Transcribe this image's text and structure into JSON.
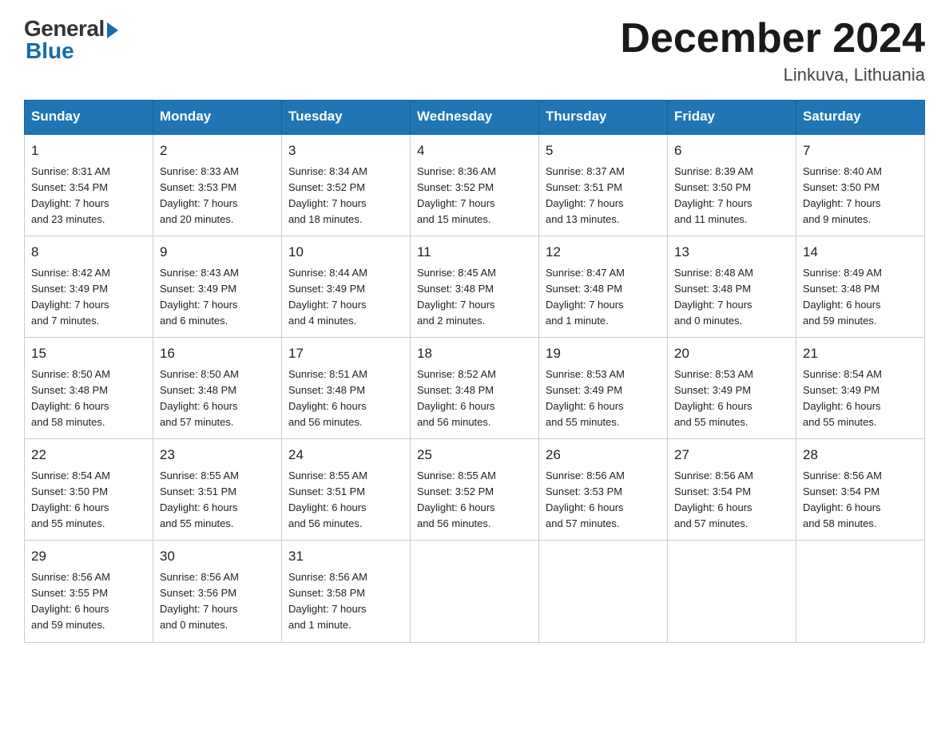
{
  "logo": {
    "general": "General",
    "blue": "Blue"
  },
  "title": "December 2024",
  "location": "Linkuva, Lithuania",
  "days_of_week": [
    "Sunday",
    "Monday",
    "Tuesday",
    "Wednesday",
    "Thursday",
    "Friday",
    "Saturday"
  ],
  "weeks": [
    [
      {
        "day": "1",
        "info": "Sunrise: 8:31 AM\nSunset: 3:54 PM\nDaylight: 7 hours\nand 23 minutes."
      },
      {
        "day": "2",
        "info": "Sunrise: 8:33 AM\nSunset: 3:53 PM\nDaylight: 7 hours\nand 20 minutes."
      },
      {
        "day": "3",
        "info": "Sunrise: 8:34 AM\nSunset: 3:52 PM\nDaylight: 7 hours\nand 18 minutes."
      },
      {
        "day": "4",
        "info": "Sunrise: 8:36 AM\nSunset: 3:52 PM\nDaylight: 7 hours\nand 15 minutes."
      },
      {
        "day": "5",
        "info": "Sunrise: 8:37 AM\nSunset: 3:51 PM\nDaylight: 7 hours\nand 13 minutes."
      },
      {
        "day": "6",
        "info": "Sunrise: 8:39 AM\nSunset: 3:50 PM\nDaylight: 7 hours\nand 11 minutes."
      },
      {
        "day": "7",
        "info": "Sunrise: 8:40 AM\nSunset: 3:50 PM\nDaylight: 7 hours\nand 9 minutes."
      }
    ],
    [
      {
        "day": "8",
        "info": "Sunrise: 8:42 AM\nSunset: 3:49 PM\nDaylight: 7 hours\nand 7 minutes."
      },
      {
        "day": "9",
        "info": "Sunrise: 8:43 AM\nSunset: 3:49 PM\nDaylight: 7 hours\nand 6 minutes."
      },
      {
        "day": "10",
        "info": "Sunrise: 8:44 AM\nSunset: 3:49 PM\nDaylight: 7 hours\nand 4 minutes."
      },
      {
        "day": "11",
        "info": "Sunrise: 8:45 AM\nSunset: 3:48 PM\nDaylight: 7 hours\nand 2 minutes."
      },
      {
        "day": "12",
        "info": "Sunrise: 8:47 AM\nSunset: 3:48 PM\nDaylight: 7 hours\nand 1 minute."
      },
      {
        "day": "13",
        "info": "Sunrise: 8:48 AM\nSunset: 3:48 PM\nDaylight: 7 hours\nand 0 minutes."
      },
      {
        "day": "14",
        "info": "Sunrise: 8:49 AM\nSunset: 3:48 PM\nDaylight: 6 hours\nand 59 minutes."
      }
    ],
    [
      {
        "day": "15",
        "info": "Sunrise: 8:50 AM\nSunset: 3:48 PM\nDaylight: 6 hours\nand 58 minutes."
      },
      {
        "day": "16",
        "info": "Sunrise: 8:50 AM\nSunset: 3:48 PM\nDaylight: 6 hours\nand 57 minutes."
      },
      {
        "day": "17",
        "info": "Sunrise: 8:51 AM\nSunset: 3:48 PM\nDaylight: 6 hours\nand 56 minutes."
      },
      {
        "day": "18",
        "info": "Sunrise: 8:52 AM\nSunset: 3:48 PM\nDaylight: 6 hours\nand 56 minutes."
      },
      {
        "day": "19",
        "info": "Sunrise: 8:53 AM\nSunset: 3:49 PM\nDaylight: 6 hours\nand 55 minutes."
      },
      {
        "day": "20",
        "info": "Sunrise: 8:53 AM\nSunset: 3:49 PM\nDaylight: 6 hours\nand 55 minutes."
      },
      {
        "day": "21",
        "info": "Sunrise: 8:54 AM\nSunset: 3:49 PM\nDaylight: 6 hours\nand 55 minutes."
      }
    ],
    [
      {
        "day": "22",
        "info": "Sunrise: 8:54 AM\nSunset: 3:50 PM\nDaylight: 6 hours\nand 55 minutes."
      },
      {
        "day": "23",
        "info": "Sunrise: 8:55 AM\nSunset: 3:51 PM\nDaylight: 6 hours\nand 55 minutes."
      },
      {
        "day": "24",
        "info": "Sunrise: 8:55 AM\nSunset: 3:51 PM\nDaylight: 6 hours\nand 56 minutes."
      },
      {
        "day": "25",
        "info": "Sunrise: 8:55 AM\nSunset: 3:52 PM\nDaylight: 6 hours\nand 56 minutes."
      },
      {
        "day": "26",
        "info": "Sunrise: 8:56 AM\nSunset: 3:53 PM\nDaylight: 6 hours\nand 57 minutes."
      },
      {
        "day": "27",
        "info": "Sunrise: 8:56 AM\nSunset: 3:54 PM\nDaylight: 6 hours\nand 57 minutes."
      },
      {
        "day": "28",
        "info": "Sunrise: 8:56 AM\nSunset: 3:54 PM\nDaylight: 6 hours\nand 58 minutes."
      }
    ],
    [
      {
        "day": "29",
        "info": "Sunrise: 8:56 AM\nSunset: 3:55 PM\nDaylight: 6 hours\nand 59 minutes."
      },
      {
        "day": "30",
        "info": "Sunrise: 8:56 AM\nSunset: 3:56 PM\nDaylight: 7 hours\nand 0 minutes."
      },
      {
        "day": "31",
        "info": "Sunrise: 8:56 AM\nSunset: 3:58 PM\nDaylight: 7 hours\nand 1 minute."
      },
      {
        "day": "",
        "info": ""
      },
      {
        "day": "",
        "info": ""
      },
      {
        "day": "",
        "info": ""
      },
      {
        "day": "",
        "info": ""
      }
    ]
  ]
}
